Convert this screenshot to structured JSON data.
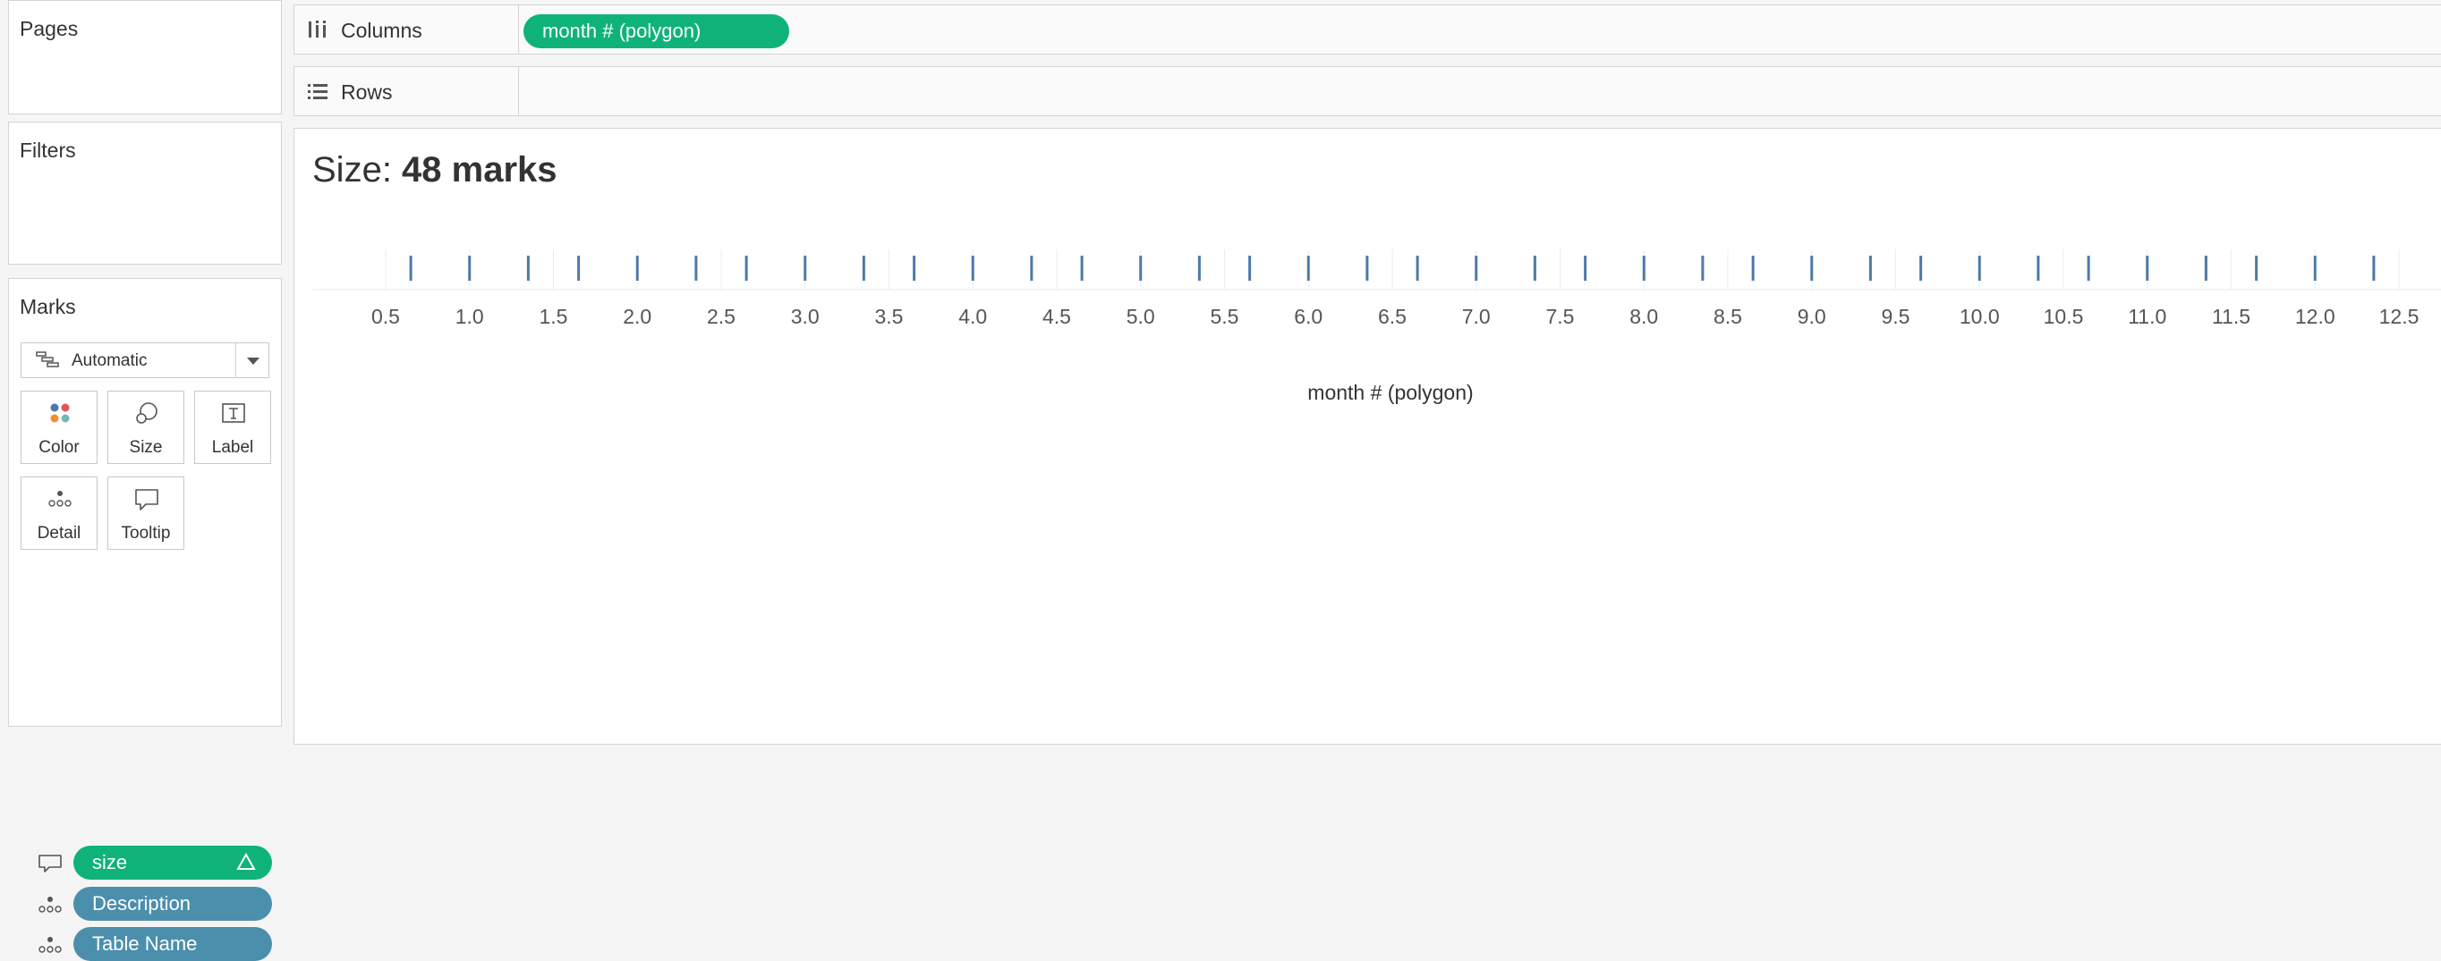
{
  "left_panel": {
    "pages_title": "Pages",
    "filters_title": "Filters",
    "marks": {
      "title": "Marks",
      "mark_type": "Automatic",
      "buttons": {
        "color": "Color",
        "size": "Size",
        "label": "Label",
        "detail": "Detail",
        "tooltip": "Tooltip"
      },
      "fields": [
        {
          "label": "size",
          "role": "tooltip",
          "color": "#0fb37a",
          "has_delta": true
        },
        {
          "label": "Description",
          "role": "detail",
          "color": "#4b8fad"
        },
        {
          "label": "Table Name",
          "role": "detail",
          "color": "#4b8fad"
        }
      ]
    }
  },
  "shelves": {
    "columns": {
      "label": "Columns",
      "pill": "month # (polygon)"
    },
    "rows": {
      "label": "Rows"
    }
  },
  "view": {
    "title_prefix": "Size: ",
    "title_value": "48 marks"
  },
  "chart_data": {
    "type": "scatter",
    "mark_shape": "tick",
    "mark_color": "#4e79a7",
    "xlabel": "month # (polygon)",
    "xlim": [
      0.3,
      12.6
    ],
    "xticks": [
      0.5,
      1.0,
      1.5,
      2.0,
      2.5,
      3.0,
      3.5,
      4.0,
      4.5,
      5.0,
      5.5,
      6.0,
      6.5,
      7.0,
      7.5,
      8.0,
      8.5,
      9.0,
      9.5,
      10.0,
      10.5,
      11.0,
      11.5,
      12.0,
      12.5
    ],
    "x": [
      0.65,
      1.0,
      1.35,
      1.65,
      2.0,
      2.35,
      2.65,
      3.0,
      3.35,
      3.65,
      4.0,
      4.35,
      4.65,
      5.0,
      5.35,
      5.65,
      6.0,
      6.35,
      6.65,
      7.0,
      7.35,
      7.65,
      8.0,
      8.35,
      8.65,
      9.0,
      9.35,
      9.65,
      10.0,
      10.35,
      10.65,
      11.0,
      11.35,
      11.65,
      12.0,
      12.35
    ]
  }
}
